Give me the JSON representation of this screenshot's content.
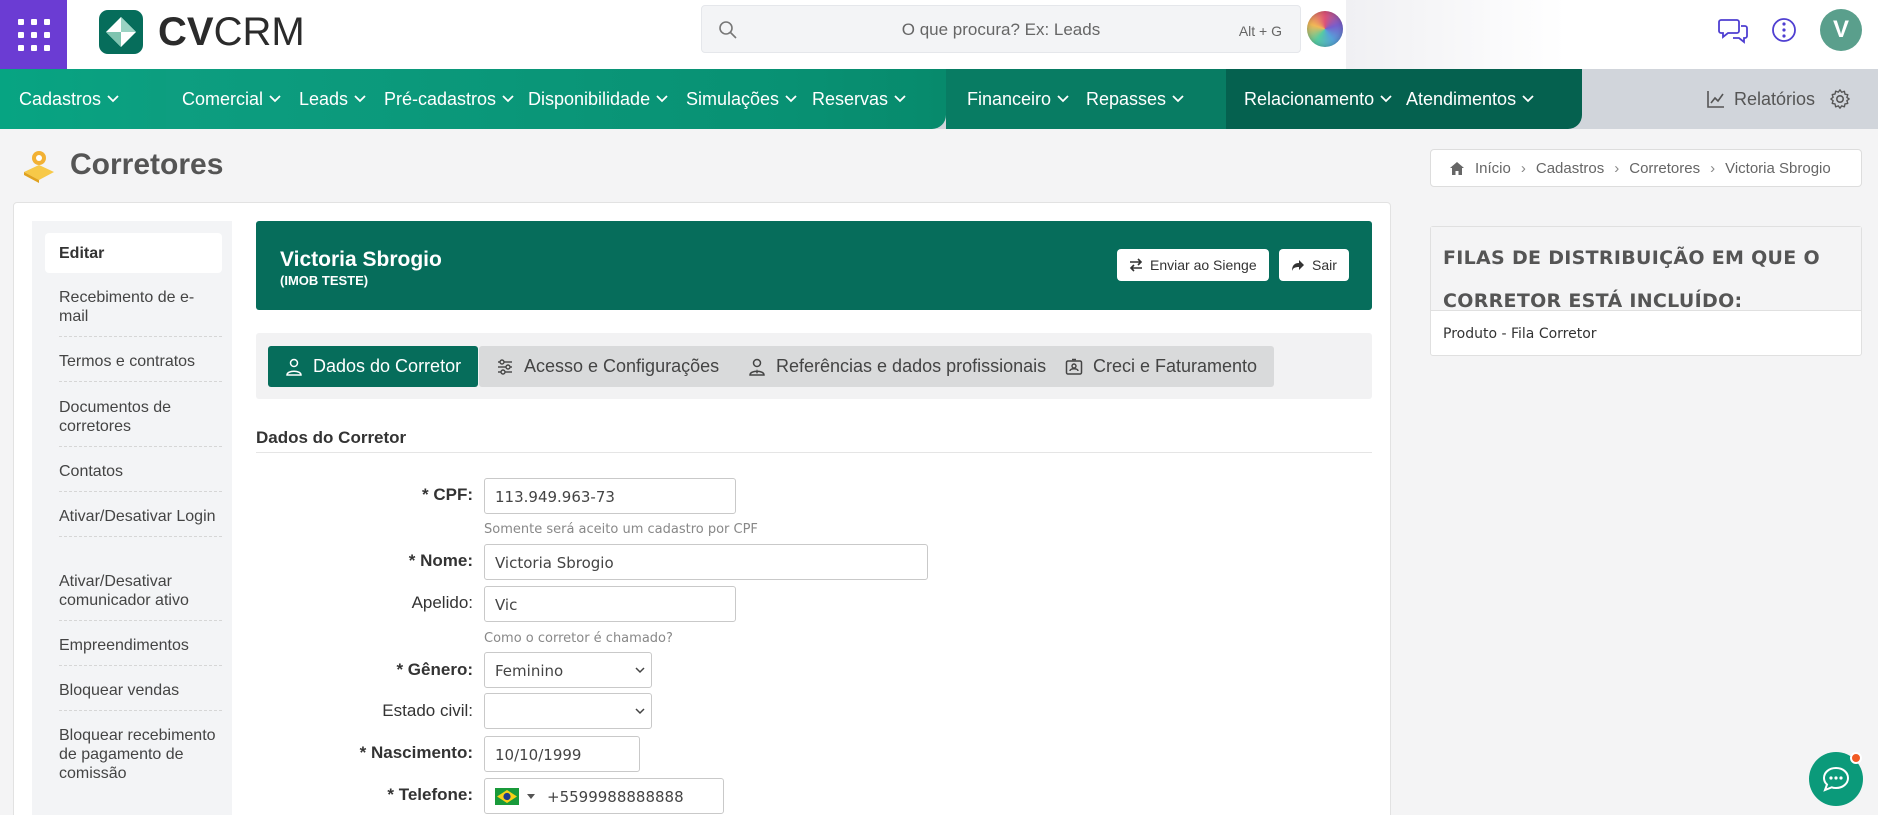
{
  "topbar": {
    "logo_text_bold": "CV",
    "logo_text_light": "CRM",
    "search_placeholder": "O que procura? Ex: Leads",
    "search_shortcut": "Alt + G",
    "avatar_initial": "V"
  },
  "menu": {
    "items": [
      "Cadastros",
      "Comercial",
      "Leads",
      "Pré-cadastros",
      "Disponibilidade",
      "Simulações",
      "Reservas",
      "Financeiro",
      "Repasses",
      "Relacionamento",
      "Atendimentos"
    ],
    "reports_label": "Relatórios"
  },
  "page": {
    "title": "Corretores"
  },
  "breadcrumb": [
    "Início",
    "Cadastros",
    "Corretores",
    "Victoria Sbrogio"
  ],
  "sidenav": {
    "active": "Editar",
    "items": [
      "Recebimento de e-mail",
      "Termos e contratos",
      "Documentos de corretores",
      "Contatos",
      "Ativar/Desativar Login",
      "Ativar/Desativar comunicador ativo",
      "Empreendimentos",
      "Bloquear vendas",
      "Bloquear recebimento de pagamento de comissão"
    ]
  },
  "header": {
    "name": "Victoria Sbrogio",
    "company": "(IMOB TESTE)",
    "send_button": "Enviar ao Sienge",
    "exit_button": "Sair"
  },
  "tabs": [
    "Dados do Corretor",
    "Acesso e Configurações",
    "Referências e dados profissionais",
    "Creci e Faturamento"
  ],
  "form": {
    "section_title": "Dados do Corretor",
    "cpf_label": "* CPF:",
    "cpf_value": "113.949.963-73",
    "cpf_help": "Somente será aceito um cadastro por CPF",
    "nome_label": "* Nome:",
    "nome_value": "Victoria Sbrogio",
    "apelido_label": "Apelido:",
    "apelido_value": "Vic",
    "apelido_help": "Como o corretor é chamado?",
    "genero_label": "* Gênero:",
    "genero_value": "Feminino",
    "estado_civil_label": "Estado civil:",
    "estado_civil_value": "",
    "nascimento_label": "* Nascimento:",
    "nascimento_value": "10/10/1999",
    "telefone_label": "* Telefone:",
    "telefone_value": "+5599988888888"
  },
  "side_panel": {
    "title_line1": "FILAS DE DISTRIBUIÇÃO EM QUE O",
    "title_line2": "CORRETOR ESTÁ INCLUÍDO:",
    "items": [
      "Produto - Fila Corretor"
    ]
  },
  "colors": {
    "primary": "#066d5b",
    "accent": "#0b9a7a",
    "apps": "#6b3cd3"
  }
}
